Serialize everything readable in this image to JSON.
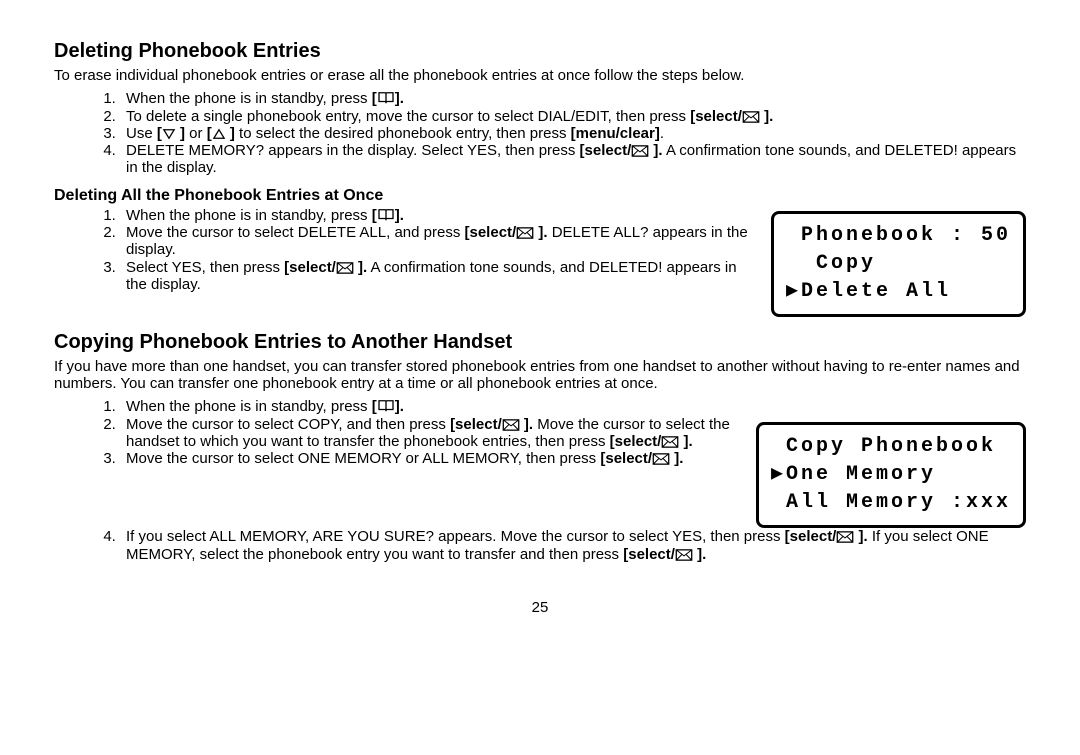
{
  "page_number": "25",
  "section1": {
    "title": "Deleting Phonebook Entries",
    "intro": "To erase individual phonebook entries or erase all the phonebook entries at once follow the steps below.",
    "steps": [
      {
        "pre": "When the phone is in standby, press ",
        "bold_open": "[",
        "icon": "book",
        "bold_close": "].",
        "post": ""
      },
      {
        "pre": "To delete a single phonebook entry, move the cursor to select DIAL/EDIT, then press ",
        "bold_open": "[select/",
        "icon": "envelope",
        "bold_close": " ].",
        "post": ""
      },
      {
        "pre": "Use ",
        "bold_open": "[",
        "icon": "down",
        "bold_close": " ]",
        "mid": " or ",
        "bold2_open": "[",
        "icon2": "up",
        "bold2_close": " ]",
        "post_pre": " to select the desired phonebook entry, then press ",
        "post_bold": "[menu/clear]",
        "post": "."
      },
      {
        "pre": "DELETE MEMORY? appears in the display. Select YES, then press",
        "bold_open": " [select/",
        "icon": "envelope",
        "bold_close": " ].",
        "post": " A confirmation tone sounds, and DELETED! appears in the display."
      }
    ],
    "sub": {
      "title": "Deleting All the Phonebook Entries at Once",
      "steps": [
        {
          "pre": "When the phone is in standby, press ",
          "bold_open": "[",
          "icon": "book",
          "bold_close": "].",
          "post": ""
        },
        {
          "pre": "Move the cursor to select DELETE ALL, and press ",
          "bold_open": "[select/",
          "icon": "envelope",
          "bold_close": " ].",
          "post": " DELETE ALL? appears in the display."
        },
        {
          "pre": "Select YES, then press ",
          "bold_open": "[select/",
          "icon": "envelope",
          "bold_close": " ].",
          "post": " A confirmation tone sounds, and DELETED! appears in the display."
        }
      ],
      "lcd": " Phonebook : 50\n  Copy\n▶Delete All"
    }
  },
  "section2": {
    "title": "Copying Phonebook Entries to Another Handset",
    "intro": "If you have more than one handset, you can transfer stored phonebook entries from one handset to another without having to re-enter names and numbers. You can transfer one phonebook entry at a time or all phonebook entries at once.",
    "steps": [
      {
        "pre": "When the phone is in standby, press ",
        "bold_open": "[",
        "icon": "book",
        "bold_close": "].",
        "post": ""
      },
      {
        "pre": "Move the cursor to select COPY, and then press ",
        "bold_open": "[select/",
        "icon": "envelope",
        "bold_close": " ].",
        "post": " Move the cursor to select the handset to which you want to transfer the phonebook entries, then press ",
        "post_bold_open": "[select/",
        "post_icon": "envelope",
        "post_bold_close": " ].",
        "post2": ""
      },
      {
        "pre": "Move the cursor to select ONE MEMORY or ALL MEMORY, then press ",
        "bold_open": "[select/",
        "icon": "envelope",
        "bold_close": " ].",
        "post": ""
      },
      {
        "pre": "If you select ALL MEMORY, ARE YOU SURE? appears. Move the cursor to select YES, then press ",
        "bold_open": "[select/",
        "icon": "envelope",
        "bold_close": " ].",
        "post": " If you select ONE MEMORY, select the phonebook entry you want to transfer and then press ",
        "post_bold_open": "[select/",
        "post_icon": "envelope",
        "post_bold_close": " ].",
        "post2": ""
      }
    ],
    "lcd": " Copy Phonebook\n▶One Memory\n All Memory :xxx"
  }
}
